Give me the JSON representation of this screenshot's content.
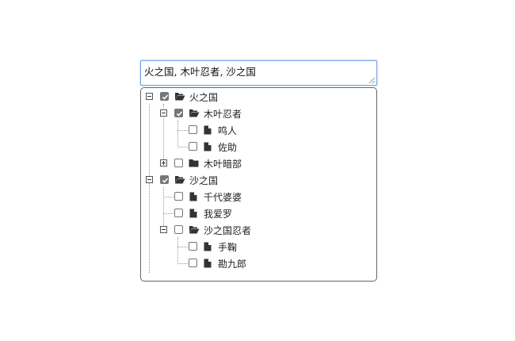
{
  "selection": {
    "value": "火之国, 木叶忍者, 沙之国"
  },
  "tree": {
    "nodes": [
      {
        "label": "火之国",
        "checked": true,
        "type": "folder-open",
        "toggle": "minus"
      },
      {
        "label": "木叶忍者",
        "checked": true,
        "type": "folder-open",
        "toggle": "minus"
      },
      {
        "label": "鸣人",
        "checked": false,
        "type": "file",
        "toggle": "none"
      },
      {
        "label": "佐助",
        "checked": false,
        "type": "file",
        "toggle": "none"
      },
      {
        "label": "木叶暗部",
        "checked": false,
        "type": "folder",
        "toggle": "plus"
      },
      {
        "label": "沙之国",
        "checked": true,
        "type": "folder-open",
        "toggle": "minus"
      },
      {
        "label": "千代婆婆",
        "checked": false,
        "type": "file",
        "toggle": "none"
      },
      {
        "label": "我爱罗",
        "checked": false,
        "type": "file",
        "toggle": "none"
      },
      {
        "label": "沙之国忍者",
        "checked": false,
        "type": "folder-open",
        "toggle": "minus"
      },
      {
        "label": "手鞠",
        "checked": false,
        "type": "file",
        "toggle": "none"
      },
      {
        "label": "勘九郎",
        "checked": false,
        "type": "file",
        "toggle": "none"
      }
    ]
  }
}
